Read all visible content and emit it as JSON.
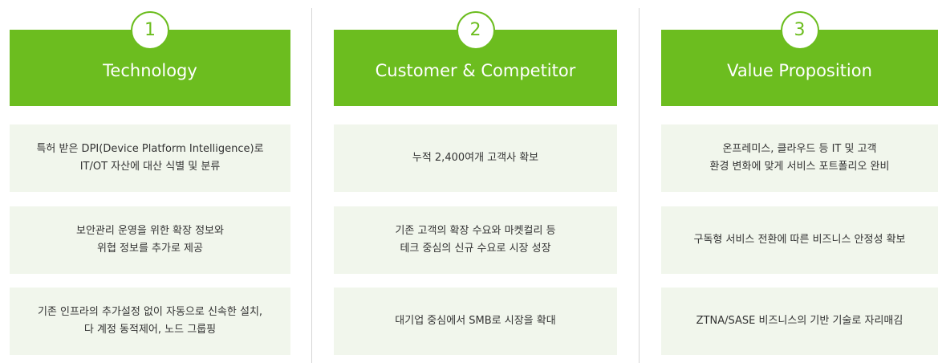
{
  "columns": [
    {
      "number": "1",
      "title": "Technology",
      "items": [
        "특허 받은 DPI(Device Platform Intelligence)로\nIT/OT 자산에 대산 식별 및 분류",
        "보안관리 운영을 위한 확장 정보와\n위협 정보를 추가로 제공",
        "기존 인프라의 추가설정 없이 자동으로 신속한 설치,\n다 계정 동적제어, 노드 그룹핑"
      ]
    },
    {
      "number": "2",
      "title": "Customer & Competitor",
      "items": [
        "누적 2,400여개 고객사 확보",
        "기존 고객의 확장 수요와 마켓컬리 등\n테크 중심의 신규 수요로 시장 성장",
        "대기업 중심에서 SMB로 시장을 확대"
      ]
    },
    {
      "number": "3",
      "title": "Value Proposition",
      "items": [
        "온프레미스, 클라우드 등 IT 및 고객\n환경 변화에 맞게 서비스 포트폴리오 완비",
        "구독형 서비스 전환에 따른 비즈니스 안정성 확보",
        "ZTNA/SASE 비즈니스의 기반 기술로 자리매김"
      ]
    }
  ],
  "colors": {
    "accent_green": "#6cbd1f",
    "card_background": "#f1f6ec",
    "divider": "#d6d6d6"
  }
}
